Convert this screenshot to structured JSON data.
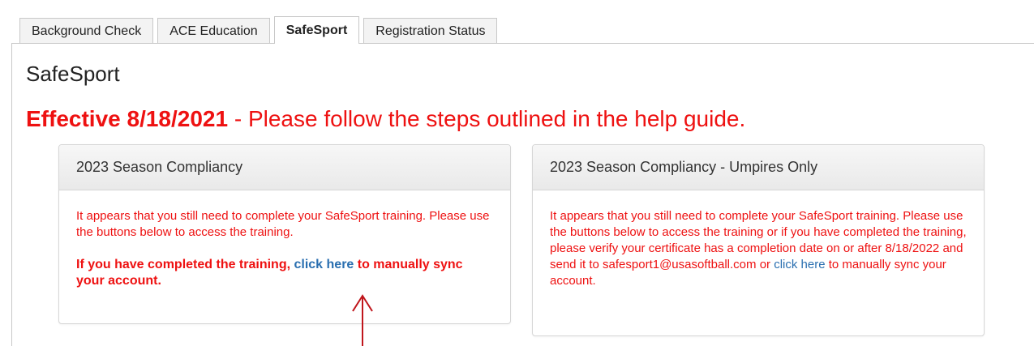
{
  "tabs": [
    {
      "label": "Background Check",
      "active": false
    },
    {
      "label": "ACE Education",
      "active": false
    },
    {
      "label": "SafeSport",
      "active": true
    },
    {
      "label": "Registration Status",
      "active": false
    }
  ],
  "page": {
    "title": "SafeSport",
    "notice_date": "Effective 8/18/2021",
    "notice_rest": " - Please follow the steps outlined in the help guide."
  },
  "panels": {
    "left": {
      "title": "2023 Season Compliancy",
      "message": "It appears that you still need to complete your SafeSport training. Please use the buttons below to access the training.",
      "sync_prefix": "If you have completed the training, ",
      "sync_link": "click here",
      "sync_suffix": " to manually sync your account."
    },
    "right": {
      "title": "2023 Season Compliancy - Umpires Only",
      "message_prefix": "It appears that you still need to complete your SafeSport training. Please use the buttons below to access the training or if you have completed the training, please verify your certificate has a completion date on or after 8/18/2022 and send it to safesport1@usasoftball.com or ",
      "link": "click here",
      "message_suffix": " to manually sync your account."
    }
  },
  "colors": {
    "alert_red": "#ee1111",
    "link_blue": "#2a6fb0",
    "arrow_red": "#c0161c"
  },
  "annotation": {
    "icon": "up-arrow-icon"
  }
}
